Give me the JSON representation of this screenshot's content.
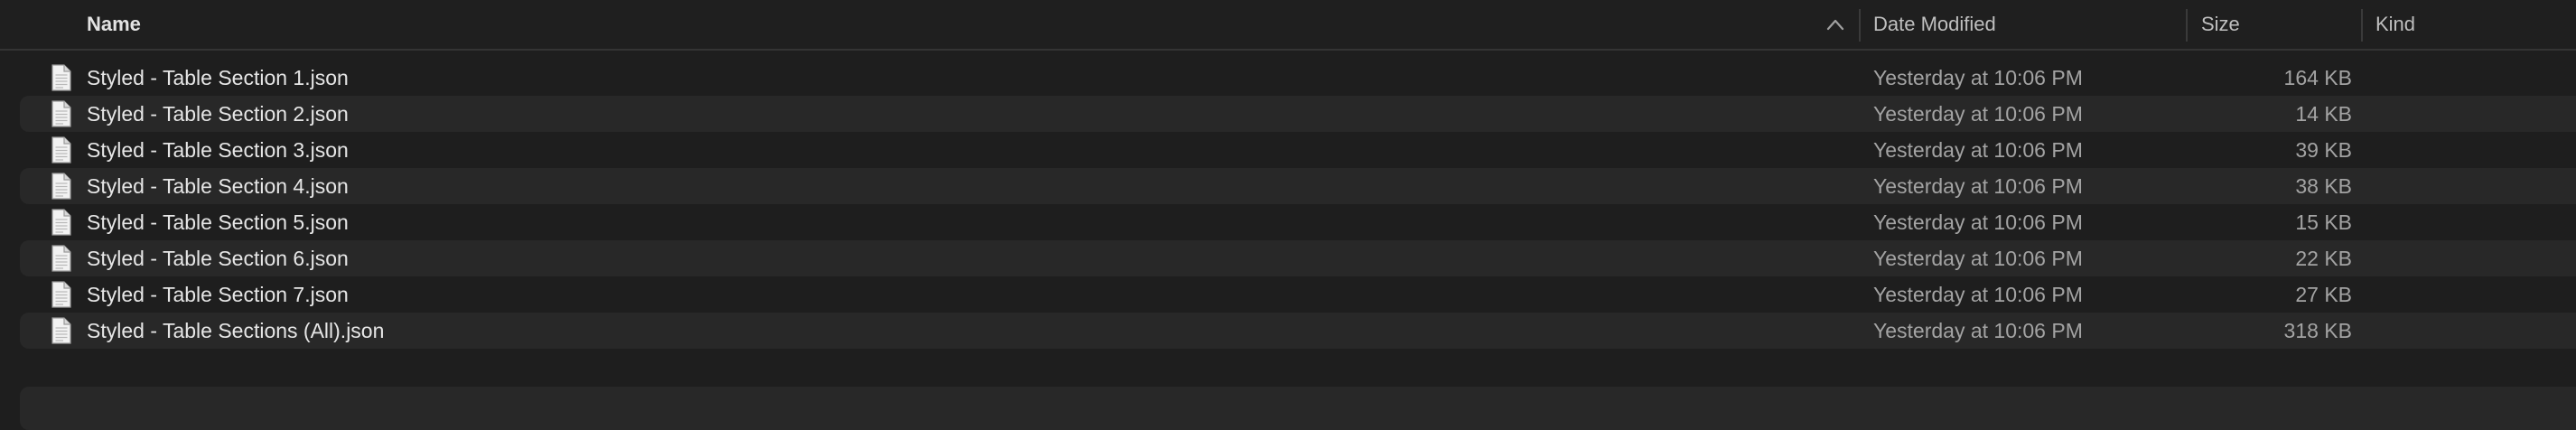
{
  "columns": {
    "name": "Name",
    "date_modified": "Date Modified",
    "size": "Size",
    "kind": "Kind"
  },
  "sort": {
    "column": "name",
    "direction": "ascending",
    "icon": "chevron-up-icon"
  },
  "files": [
    {
      "name": "Styled - Table Section 1.json",
      "date_modified": "Yesterday at 10:06 PM",
      "size": "164 KB",
      "kind": "",
      "icon": "document-icon"
    },
    {
      "name": "Styled - Table Section 2.json",
      "date_modified": "Yesterday at 10:06 PM",
      "size": "14 KB",
      "kind": "",
      "icon": "document-icon"
    },
    {
      "name": "Styled - Table Section 3.json",
      "date_modified": "Yesterday at 10:06 PM",
      "size": "39 KB",
      "kind": "",
      "icon": "document-icon"
    },
    {
      "name": "Styled - Table Section 4.json",
      "date_modified": "Yesterday at 10:06 PM",
      "size": "38 KB",
      "kind": "",
      "icon": "document-icon"
    },
    {
      "name": "Styled - Table Section 5.json",
      "date_modified": "Yesterday at 10:06 PM",
      "size": "15 KB",
      "kind": "",
      "icon": "document-icon"
    },
    {
      "name": "Styled - Table Section 6.json",
      "date_modified": "Yesterday at 10:06 PM",
      "size": "22 KB",
      "kind": "",
      "icon": "document-icon"
    },
    {
      "name": "Styled - Table Section 7.json",
      "date_modified": "Yesterday at 10:06 PM",
      "size": "27 KB",
      "kind": "",
      "icon": "document-icon"
    },
    {
      "name": "Styled - Table Sections (All).json",
      "date_modified": "Yesterday at 10:06 PM",
      "size": "318 KB",
      "kind": "",
      "icon": "document-icon"
    }
  ],
  "colors": {
    "background": "#1e1e1e",
    "row_alt": "#282828",
    "text_primary": "#e6e6e6",
    "text_secondary": "#a3a3a3"
  }
}
